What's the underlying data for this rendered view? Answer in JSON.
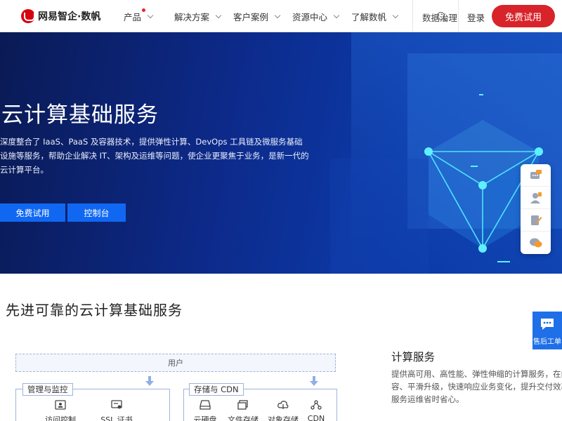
{
  "nav": {
    "logo_text": "网易智企·数帆",
    "items": [
      {
        "label": "产品",
        "has_dot": true
      },
      {
        "label": "解决方案"
      },
      {
        "label": "客户案例"
      },
      {
        "label": "资源中心"
      },
      {
        "label": "了解数帆"
      }
    ],
    "data_governance": "数据治理",
    "login": "登录",
    "trial": "免费试用"
  },
  "hero": {
    "title": "云计算基础服务",
    "description": "深度整合了 IaaS、PaaS 及容器技术，提供弹性计算、DevOps 工具链及微服务基础设施等服务，帮助企业解决 IT、架构及运维等问题，使企业更聚焦于业务，是新一代的云计算平台。",
    "buttons": {
      "trial": "免费试用",
      "console": "控制台"
    }
  },
  "side_tools": [
    "consult-icon",
    "support-person-icon",
    "feedback-icon",
    "chat-icon"
  ],
  "after_sales": {
    "label": "售后工单"
  },
  "section": {
    "title": "先进可靠的云计算基础服务",
    "diagram": {
      "user_bar": "用户",
      "groups": [
        {
          "label": "管理与监控",
          "services": [
            "访问控制",
            "SSL 证书"
          ]
        },
        {
          "label": "存储与 CDN",
          "services": [
            "云硬盘",
            "文件存储",
            "对象存储",
            "CDN"
          ]
        }
      ]
    },
    "side": {
      "title": "计算服务",
      "lines": [
        "提供高可用、高性能、弹性伸缩的计算服务，在线扩",
        "容、平滑升级，快速响应业务变化，提升交付效率，",
        "服务运维省时省心。"
      ]
    }
  },
  "colors": {
    "brand_red": "#d8232a",
    "primary_blue": "#1068f2",
    "hero_dark": "#0a1a55"
  }
}
